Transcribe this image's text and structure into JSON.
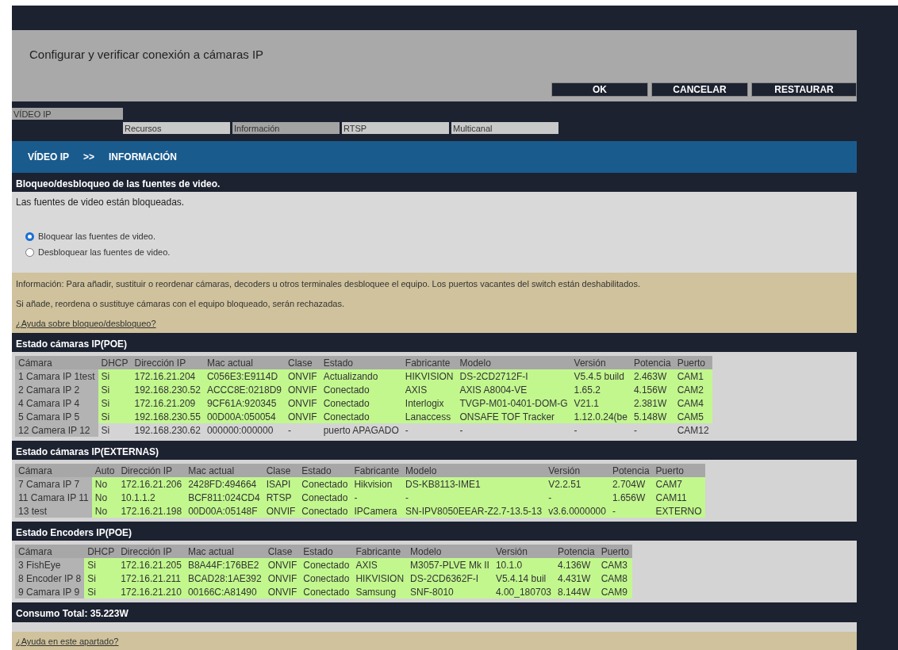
{
  "header": {
    "title": "Configurar y verificar conexión a cámaras IP",
    "buttons": [
      "OK",
      "CANCELAR",
      "RESTAURAR"
    ]
  },
  "tabs": [
    {
      "label": "VÍDEO IP",
      "selected": true
    }
  ],
  "subtabs": [
    {
      "label": "Recursos",
      "selected": false
    },
    {
      "label": "Información",
      "selected": true
    },
    {
      "label": "RTSP",
      "selected": false
    },
    {
      "label": "Multicanal",
      "selected": false
    }
  ],
  "breadcrumb": [
    "VÍDEO IP",
    ">>",
    "INFORMACIÓN"
  ],
  "lock_section": {
    "title": "Bloqueo/desbloqueo de las fuentes de video.",
    "status": "Las fuentes de video están bloqueadas.",
    "options": [
      {
        "label": "Bloquear las fuentes de video.",
        "selected": true
      },
      {
        "label": "Desbloquear las fuentes de video.",
        "selected": false
      }
    ]
  },
  "info": {
    "lines": [
      "Información: Para añadir, sustituir o reordenar cámaras, decoders u otros terminales desbloquee el equipo. Los puertos vacantes del switch están deshabilitados.",
      "Si añade, reordena o sustituye cámaras con el equipo bloqueado, serán rechazadas."
    ],
    "link": "¿Ayuda sobre bloqueo/desbloqueo?"
  },
  "tables": [
    {
      "title": "Estado cámaras IP(POE)",
      "columns": [
        "Cámara",
        "DHCP",
        "Dirección IP",
        "Mac actual",
        "Clase",
        "Estado",
        "Fabricante",
        "Modelo",
        "Versión",
        "Potencia",
        "Puerto"
      ],
      "rows": [
        {
          "active": true,
          "cells": [
            "1  Camara IP 1test",
            "Si",
            "172.16.21.204",
            "C056E3:E9114D",
            "ONVIF",
            "Actualizando",
            "HIKVISION",
            "DS-2CD2712F-I",
            "V5.4.5 build",
            "2.463W",
            "CAM1"
          ]
        },
        {
          "active": true,
          "cells": [
            "2  Camara IP 2",
            "Si",
            "192.168.230.52",
            "ACCC8E:0218D9",
            "ONVIF",
            "Conectado",
            "AXIS",
            "AXIS A8004-VE",
            "1.65.2",
            "4.156W",
            "CAM2"
          ]
        },
        {
          "active": true,
          "cells": [
            "4  Camara IP 4",
            "Si",
            "172.16.21.209",
            "9CF61A:920345",
            "ONVIF",
            "Conectado",
            "Interlogix",
            "TVGP-M01-0401-DOM-G",
            "V21.1",
            "2.381W",
            "CAM4"
          ]
        },
        {
          "active": true,
          "cells": [
            "5  Camara IP 5",
            "Si",
            "192.168.230.55",
            "00D00A:050054",
            "ONVIF",
            "Conectado",
            "Lanaccess",
            "ONSAFE TOF Tracker",
            "1.12.0.24(be",
            "5.148W",
            "CAM5"
          ]
        },
        {
          "active": false,
          "cells": [
            "12 Camera IP 12",
            "Si",
            "192.168.230.62",
            "000000:000000",
            "-",
            "puerto APAGADO",
            "-",
            "-",
            "-",
            "-",
            "CAM12"
          ]
        }
      ]
    },
    {
      "title": "Estado cámaras IP(EXTERNAS)",
      "columns": [
        "Cámara",
        "Auto",
        "Dirección IP",
        "Mac actual",
        "Clase",
        "Estado",
        "Fabricante",
        "Modelo",
        "Versión",
        "Potencia",
        "Puerto"
      ],
      "rows": [
        {
          "active": true,
          "cells": [
            "7  Camara IP 7",
            "No",
            "172.16.21.206",
            "2428FD:494664",
            "ISAPI",
            "Conectado",
            "Hikvision",
            "DS-KB8113-IME1",
            "V2.2.51",
            "2.704W",
            "CAM7"
          ]
        },
        {
          "active": true,
          "cells": [
            "11 Camara IP 11",
            "No",
            "10.1.1.2",
            "BCF811:024CD4",
            "RTSP",
            "Conectado",
            "-",
            "-",
            "-",
            "1.656W",
            "CAM11"
          ]
        },
        {
          "active": true,
          "cells": [
            "13 test",
            "No",
            "172.16.21.198",
            "00D00A:05148F",
            "ONVIF",
            "Conectado",
            "IPCamera",
            "SN-IPV8050EEAR-Z2.7-13.5-13",
            "v3.6.0000000",
            "-",
            "EXTERNO"
          ]
        }
      ]
    },
    {
      "title": "Estado Encoders IP(POE)",
      "columns": [
        "Cámara",
        "DHCP",
        "Dirección IP",
        "Mac actual",
        "Clase",
        "Estado",
        "Fabricante",
        "Modelo",
        "Versión",
        "Potencia",
        "Puerto"
      ],
      "rows": [
        {
          "active": true,
          "cells": [
            "3  FishEye",
            "Si",
            "172.16.21.205",
            "B8A44F:176BE2",
            "ONVIF",
            "Conectado",
            "AXIS",
            "M3057-PLVE Mk II",
            "10.1.0",
            "4.136W",
            "CAM3"
          ]
        },
        {
          "active": true,
          "cells": [
            "8  Encoder IP 8",
            "Si",
            "172.16.21.211",
            "BCAD28:1AE392",
            "ONVIF",
            "Conectado",
            "HIKVISION",
            "DS-2CD6362F-I",
            "V5.4.14 buil",
            "4.431W",
            "CAM8"
          ]
        },
        {
          "active": true,
          "cells": [
            "9  Camara IP 9",
            "Si",
            "172.16.21.210",
            "00166C:A81490",
            "ONVIF",
            "Conectado",
            "Samsung",
            "SNF-8010",
            "4.00_180703",
            "8.144W",
            "CAM9"
          ]
        }
      ]
    }
  ],
  "total": "Consumo Total: 35.223W",
  "help_link": "¿Ayuda en este apartado?"
}
